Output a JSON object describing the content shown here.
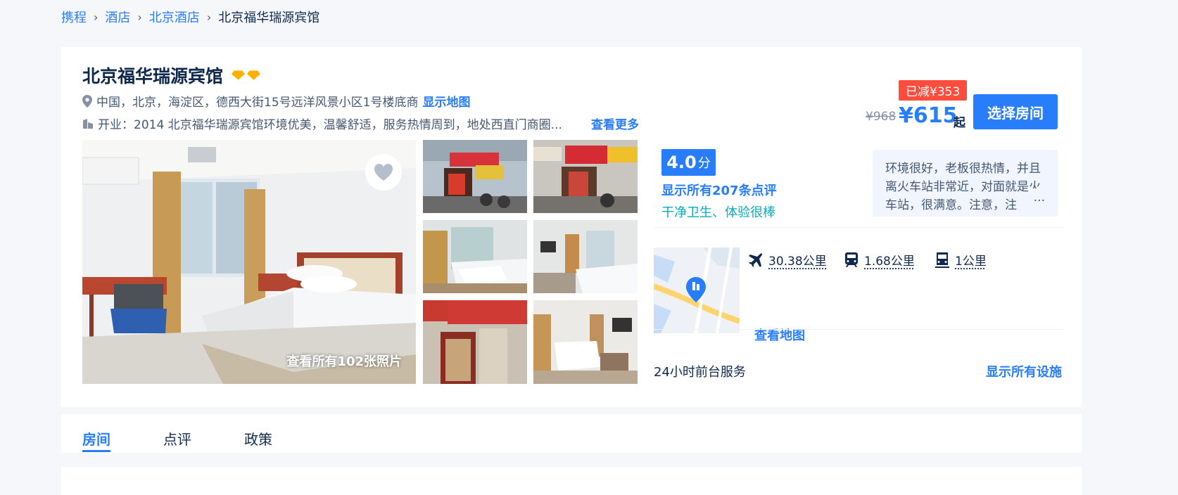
{
  "breadcrumb": {
    "items": [
      "携程",
      "酒店",
      "北京酒店"
    ],
    "current": "北京福华瑞源宾馆",
    "sep": "›"
  },
  "hotel": {
    "name": "北京福华瑞源宾馆",
    "address": "中国，北京，海淀区，德西大街15号远洋风景小区1号楼底商",
    "show_map": "显示地图",
    "intro": "开业：2014  北京福华瑞源宾馆环境优美，温馨舒适，服务热情周到，地处西直门商圈...",
    "see_more": "查看更多"
  },
  "photos": {
    "all_label": "查看所有102张照片"
  },
  "price": {
    "reduced": "已减¥353",
    "original": "¥968",
    "current": "¥615",
    "from": "起",
    "select_room": "选择房间"
  },
  "rating": {
    "score": "4.0",
    "unit": "分",
    "all_reviews": "显示所有207条点评",
    "tags": "干净卫生、体验很棒",
    "quote": "环境很好，老板很热情，并且离火车站非常近，对面就是火车站，很满意。注意，注",
    "quote_ellipsis": "..."
  },
  "transport": {
    "airport": "30.38公里",
    "train": "1.68公里",
    "metro": "1公里",
    "view_map": "查看地图"
  },
  "facilities": {
    "front_desk": "24小时前台服务",
    "all_facilities": "显示所有设施"
  },
  "tabs": [
    "房间",
    "点评",
    "政策"
  ],
  "colors": {
    "accent": "#287dfa",
    "reduced_bg": "#ff4c3c",
    "tag_green": "#06aebd",
    "diamond": "#ffb000"
  }
}
